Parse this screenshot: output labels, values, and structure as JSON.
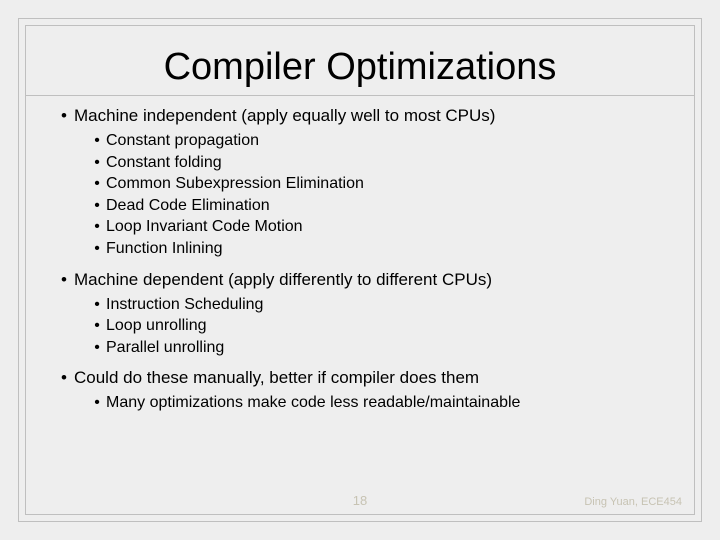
{
  "title": "Compiler Optimizations",
  "sections": [
    {
      "heading": "Machine independent (apply equally well to most CPUs)",
      "items": [
        "Constant propagation",
        "Constant folding",
        "Common Subexpression Elimination",
        "Dead Code Elimination",
        "Loop Invariant Code Motion",
        "Function Inlining"
      ]
    },
    {
      "heading": "Machine dependent (apply differently to different CPUs)",
      "items": [
        "Instruction Scheduling",
        "Loop unrolling",
        "Parallel unrolling"
      ]
    },
    {
      "heading": "Could do these manually, better if compiler does them",
      "items": [
        "Many optimizations make code less readable/maintainable"
      ]
    }
  ],
  "page_number": "18",
  "credit": "Ding Yuan, ECE454"
}
